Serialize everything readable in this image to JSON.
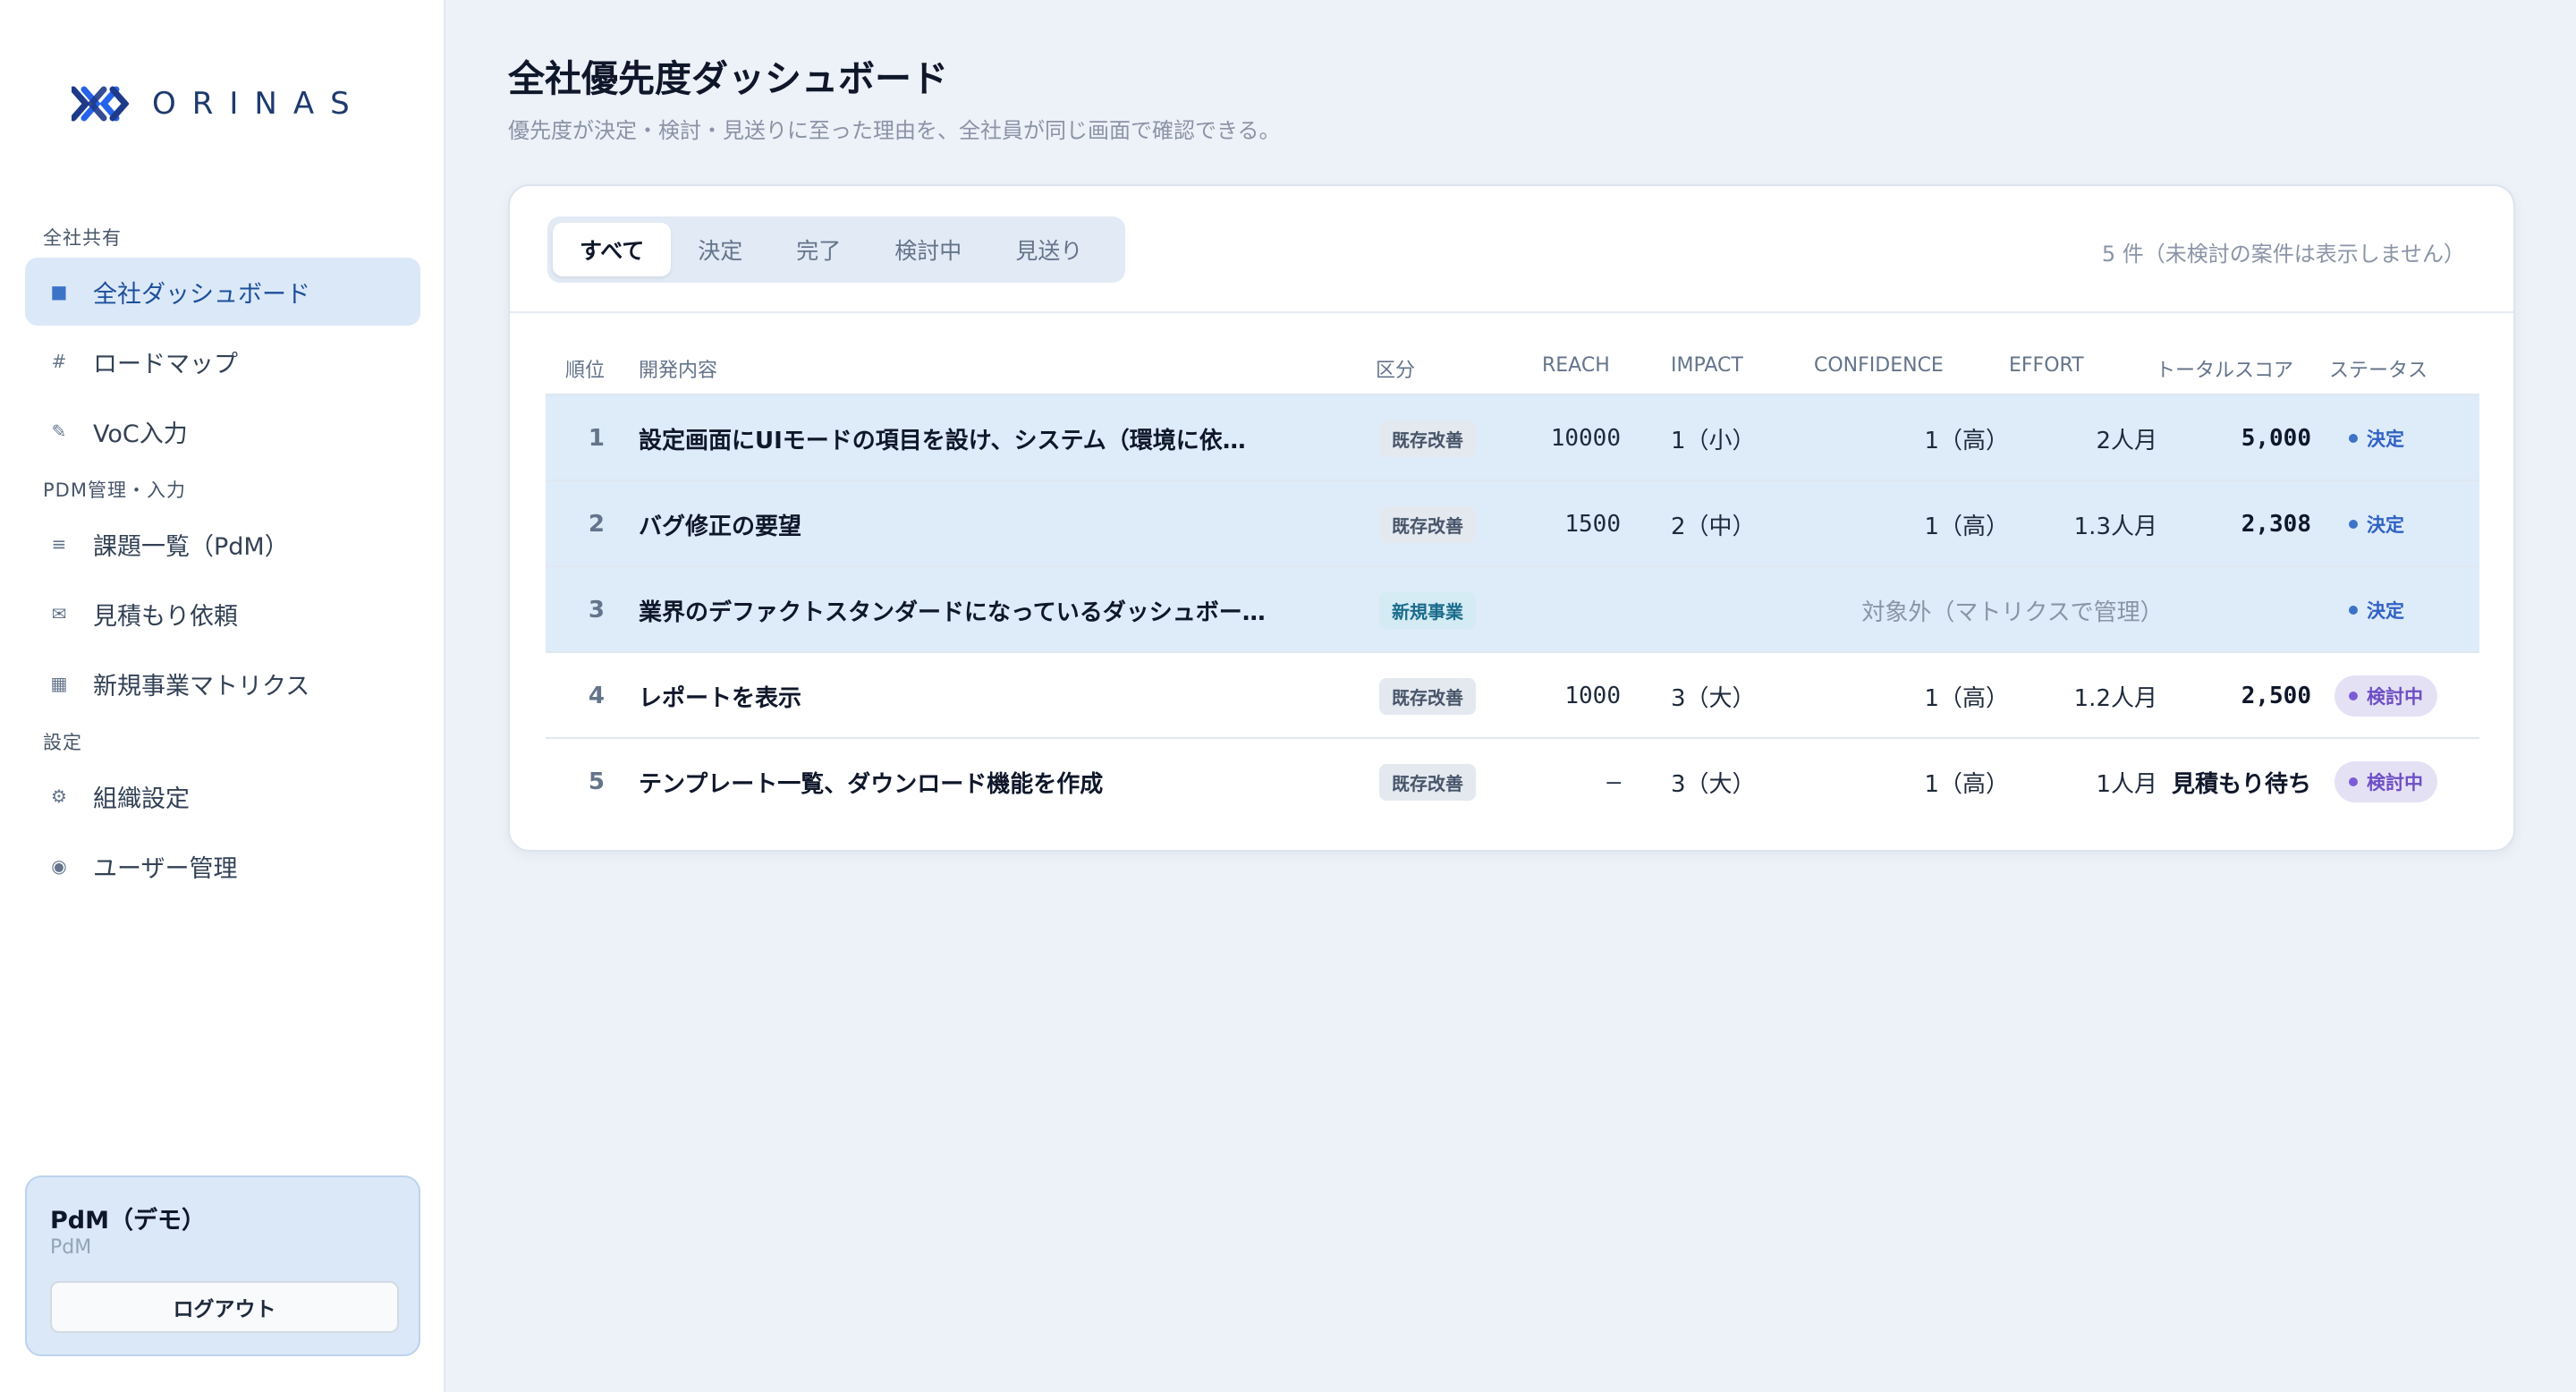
{
  "brand": {
    "name": "ORINAS"
  },
  "sidebar": {
    "sections": [
      {
        "label": "全社共有"
      },
      {
        "label": "PDM管理・入力"
      },
      {
        "label": "設定"
      }
    ],
    "items": [
      {
        "label": "全社ダッシュボード",
        "icon": "grid-square-icon"
      },
      {
        "label": "ロードマップ",
        "icon": "hash-icon"
      },
      {
        "label": "VoC入力",
        "icon": "pencil-icon"
      },
      {
        "label": "課題一覧（PdM）",
        "icon": "list-icon"
      },
      {
        "label": "見積もり依頼",
        "icon": "mail-icon"
      },
      {
        "label": "新規事業マトリクス",
        "icon": "matrix-icon"
      },
      {
        "label": "組織設定",
        "icon": "gear-icon"
      },
      {
        "label": "ユーザー管理",
        "icon": "user-circle-icon"
      }
    ],
    "user": {
      "name": "PdM（デモ）",
      "role": "PdM",
      "logout_label": "ログアウト"
    }
  },
  "header": {
    "title": "全社優先度ダッシュボード",
    "subtitle": "優先度が決定・検討・見送りに至った理由を、全社員が同じ画面で確認できる。"
  },
  "tabs": [
    "すべて",
    "決定",
    "完了",
    "検討中",
    "見送り"
  ],
  "active_tab": "すべて",
  "count_text": "5 件（未検討の案件は表示しません）",
  "table": {
    "headers": {
      "rank": "順位",
      "title": "開発内容",
      "category": "区分",
      "reach": "REACH",
      "impact": "IMPACT",
      "confidence": "CONFIDENCE",
      "effort": "EFFORT",
      "total": "トータルスコア",
      "status": "ステータス"
    },
    "rows": [
      {
        "rank": "1",
        "title": "設定画面にUIモードの項目を設け、システム（環境に依…",
        "category": "既存改善",
        "reach": "10000",
        "impact": "1（小）",
        "confidence": "1（高）",
        "effort": "2人月",
        "total": "5,000",
        "status": "決定"
      },
      {
        "rank": "2",
        "title": "バグ修正の要望",
        "category": "既存改善",
        "reach": "1500",
        "impact": "2（中）",
        "confidence": "1（高）",
        "effort": "1.3人月",
        "total": "2,308",
        "status": "決定"
      },
      {
        "rank": "3",
        "title": "業界のデファクトスタンダードになっているダッシュボー…",
        "category": "新規事業",
        "out_of_scope": "対象外（マトリクスで管理）",
        "status": "決定"
      },
      {
        "rank": "4",
        "title": "レポートを表示",
        "category": "既存改善",
        "reach": "1000",
        "impact": "3（大）",
        "confidence": "1（高）",
        "effort": "1.2人月",
        "total": "2,500",
        "status": "検討中"
      },
      {
        "rank": "5",
        "title": "テンプレート一覧、ダウンロード機能を作成",
        "category": "既存改善",
        "reach": "–",
        "impact": "3（大）",
        "confidence": "1（高）",
        "effort": "1人月",
        "total": "見積もり待ち",
        "status": "検討中"
      }
    ]
  },
  "colors": {
    "accent": "#3b73c7",
    "highlight_row": "#deebf9",
    "review_badge": "#e5e1f5"
  }
}
